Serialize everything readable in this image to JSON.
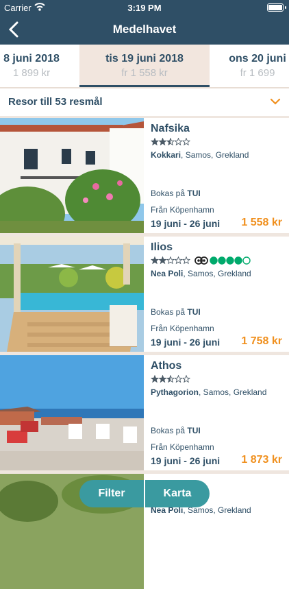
{
  "status_bar": {
    "carrier": "Carrier",
    "time": "3:19 PM"
  },
  "nav": {
    "title": "Medelhavet"
  },
  "date_tabs": [
    {
      "date": "8 juni 2018",
      "price": "1 899 kr"
    },
    {
      "date": "tis 19 juni 2018",
      "price": "fr 1 558 kr"
    },
    {
      "date": "ons 20 juni",
      "price": "fr 1 699"
    }
  ],
  "destinations_label": "Resor till 53 resmål",
  "hotels": [
    {
      "name": "Nafsika",
      "rating": 2.5,
      "place": "Kokkari",
      "region": ", Samos, Grekland",
      "booked_prefix": "Bokas på ",
      "operator": "TUI",
      "from": "Från Köpenhamn",
      "dates": "19 juni - 26 juni",
      "price": "1 558 kr"
    },
    {
      "name": "Ilios",
      "rating": 2,
      "tripadvisor": 4,
      "place": "Nea Poli",
      "region": ", Samos, Grekland",
      "booked_prefix": "Bokas på ",
      "operator": "TUI",
      "from": "Från Köpenhamn",
      "dates": "19 juni - 26 juni",
      "price": "1 758 kr"
    },
    {
      "name": "Athos",
      "rating": 2.5,
      "place": "Pythagorion",
      "region": ", Samos, Grekland",
      "booked_prefix": "Bokas på ",
      "operator": "TUI",
      "from": "Från Köpenhamn",
      "dates": "19 juni - 26 juni",
      "price": "1 873 kr"
    },
    {
      "name": "",
      "place": "Nea Poli",
      "region": ", Samos, Grekland"
    }
  ],
  "buttons": {
    "filter": "Filter",
    "map": "Karta"
  },
  "colors": {
    "header": "#2f4f66",
    "accent": "#f0901e",
    "fab": "#3a9aa0",
    "tripadvisor": "#00aa6c"
  }
}
